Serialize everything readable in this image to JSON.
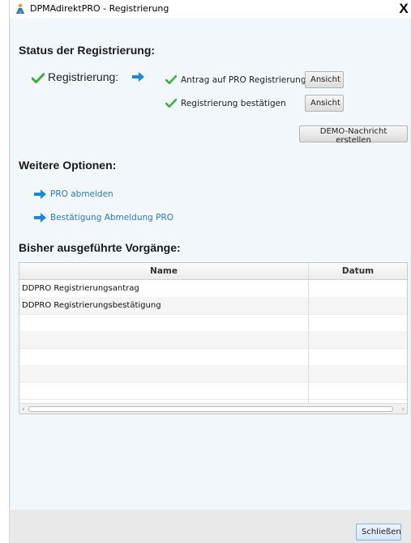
{
  "window": {
    "title": "DPMAdirektPRO - Registrierung",
    "close": "X"
  },
  "status": {
    "heading": "Status der Registrierung:",
    "main_label": "Registrierung:",
    "items": [
      {
        "label": "Antrag auf PRO Registrierung",
        "button": "Ansicht"
      },
      {
        "label": "Registrierung bestätigen",
        "button": "Ansicht"
      }
    ],
    "demo_button": "DEMO-Nachricht erstellen"
  },
  "options": {
    "heading": "Weitere Optionen:",
    "links": [
      "PRO abmelden",
      "Bestätigung Abmeldung PRO"
    ]
  },
  "history": {
    "heading": "Bisher ausgeführte Vorgänge:",
    "columns": [
      "Name",
      "Datum"
    ],
    "rows": [
      {
        "name": "DDPRO Registrierungsantrag",
        "date": ""
      },
      {
        "name": "DDPRO Registrierungsbestätigung",
        "date": ""
      }
    ]
  },
  "footer": {
    "close_button": "Schließen"
  },
  "colors": {
    "check": "#3fae3a",
    "arrow": "#1e88d8",
    "link": "#2a7bbd",
    "content_bg": "#f2f7fb"
  }
}
